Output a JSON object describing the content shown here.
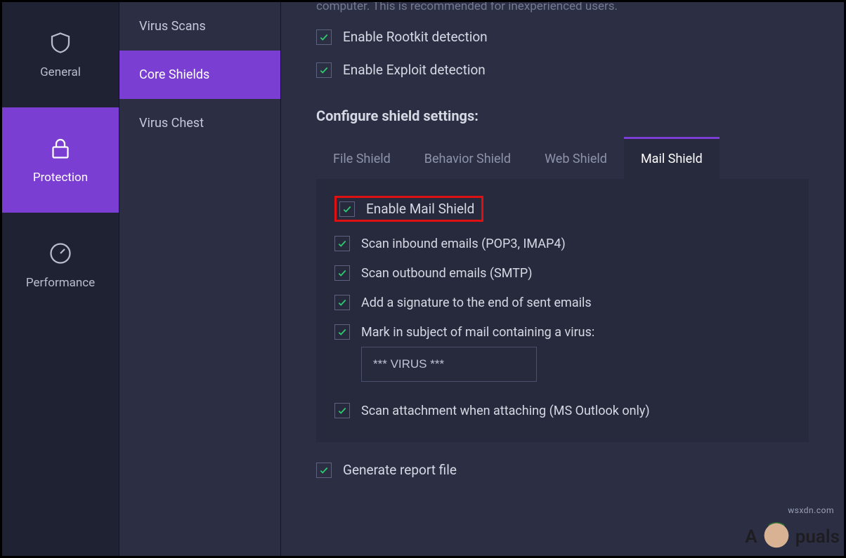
{
  "rail": {
    "items": [
      {
        "label": "General"
      },
      {
        "label": "Protection"
      },
      {
        "label": "Performance"
      }
    ],
    "activeIndex": 1
  },
  "subnav": {
    "items": [
      {
        "label": "Virus Scans"
      },
      {
        "label": "Core Shields"
      },
      {
        "label": "Virus Chest"
      }
    ],
    "activeIndex": 1
  },
  "truncated_top_text": "computer. This is recommended for inexperienced users.",
  "top_checks": [
    {
      "label": "Enable Rootkit detection",
      "checked": true
    },
    {
      "label": "Enable Exploit detection",
      "checked": true
    }
  ],
  "section_title": "Configure shield settings:",
  "tabs": {
    "items": [
      {
        "label": "File Shield"
      },
      {
        "label": "Behavior Shield"
      },
      {
        "label": "Web Shield"
      },
      {
        "label": "Mail Shield"
      }
    ],
    "activeIndex": 3
  },
  "mail_shield": {
    "enable_label": "Enable Mail Shield",
    "enable_checked": true,
    "options": [
      {
        "label": "Scan inbound emails (POP3, IMAP4)",
        "checked": true
      },
      {
        "label": "Scan outbound emails (SMTP)",
        "checked": true
      },
      {
        "label": "Add a signature to the end of sent emails",
        "checked": true
      },
      {
        "label": "Mark in subject of mail containing a virus:",
        "checked": true
      }
    ],
    "virus_subject_value": "*** VIRUS ***",
    "attachment_label": "Scan attachment when attaching (MS Outlook only)",
    "attachment_checked": true
  },
  "bottom_check": {
    "label": "Generate report file",
    "checked": true
  },
  "watermark": {
    "brand_left": "A",
    "brand_right": "puals"
  },
  "site_mark": "wsxdn.com"
}
